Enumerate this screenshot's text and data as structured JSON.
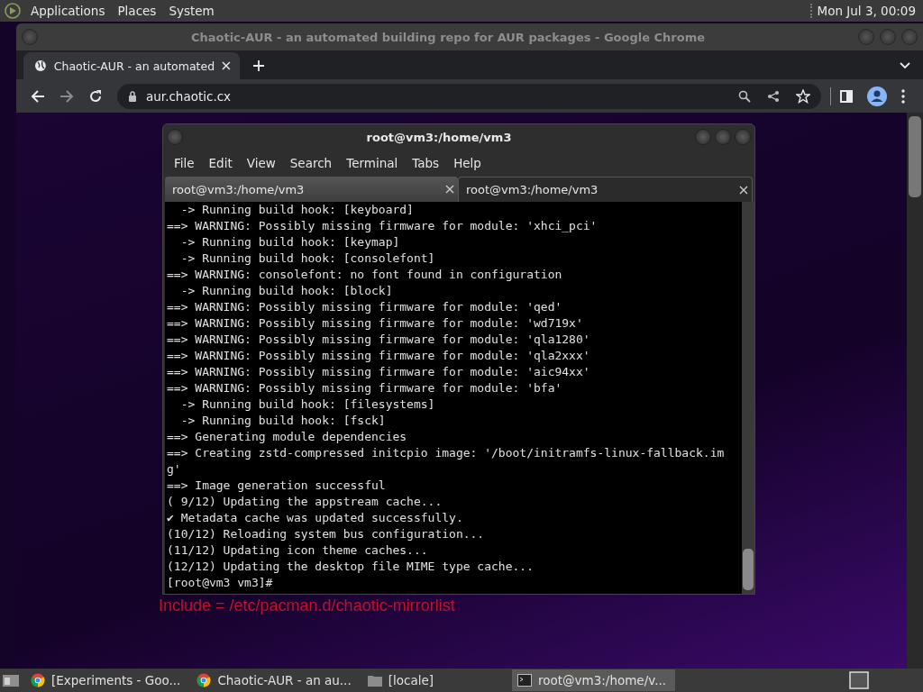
{
  "top_panel": {
    "menus": [
      "Applications",
      "Places",
      "System"
    ],
    "clock": "Mon Jul 3, 00:09"
  },
  "browser": {
    "window_title": "Chaotic-AUR - an automated building repo for AUR packages - Google Chrome",
    "tabs": [
      {
        "label": "Chaotic-AUR - an automated",
        "selected": true
      }
    ],
    "url": "aur.chaotic.cx",
    "page_text": "Include = /etc/pacman.d/chaotic-mirrorlist"
  },
  "terminal": {
    "title": "root@vm3:/home/vm3",
    "menus": [
      "File",
      "Edit",
      "View",
      "Search",
      "Terminal",
      "Tabs",
      "Help"
    ],
    "tabs": [
      {
        "label": "root@vm3:/home/vm3",
        "selected": false
      },
      {
        "label": "root@vm3:/home/vm3",
        "selected": true
      }
    ],
    "lines": [
      "  -> Running build hook: [keyboard]",
      "==> WARNING: Possibly missing firmware for module: 'xhci_pci'",
      "  -> Running build hook: [keymap]",
      "  -> Running build hook: [consolefont]",
      "==> WARNING: consolefont: no font found in configuration",
      "  -> Running build hook: [block]",
      "==> WARNING: Possibly missing firmware for module: 'qed'",
      "==> WARNING: Possibly missing firmware for module: 'wd719x'",
      "==> WARNING: Possibly missing firmware for module: 'qla1280'",
      "==> WARNING: Possibly missing firmware for module: 'qla2xxx'",
      "==> WARNING: Possibly missing firmware for module: 'aic94xx'",
      "==> WARNING: Possibly missing firmware for module: 'bfa'",
      "  -> Running build hook: [filesystems]",
      "  -> Running build hook: [fsck]",
      "==> Generating module dependencies",
      "==> Creating zstd-compressed initcpio image: '/boot/initramfs-linux-fallback.img'",
      "==> Image generation successful",
      "( 9/12) Updating the appstream cache...",
      "✔ Metadata cache was updated successfully.",
      "(10/12) Reloading system bus configuration...",
      "(11/12) Updating icon theme caches...",
      "(12/12) Updating the desktop file MIME type cache...",
      "[root@vm3 vm3]#"
    ]
  },
  "taskbar": {
    "items": [
      {
        "kind": "chrome",
        "label": "[Experiments - Goo...",
        "selected": false
      },
      {
        "kind": "chrome",
        "label": "Chaotic-AUR - an au...",
        "selected": false
      },
      {
        "kind": "folder",
        "label": "[locale]",
        "selected": false
      },
      {
        "kind": "terminal",
        "label": "root@vm3:/home/v...",
        "selected": true
      }
    ]
  }
}
